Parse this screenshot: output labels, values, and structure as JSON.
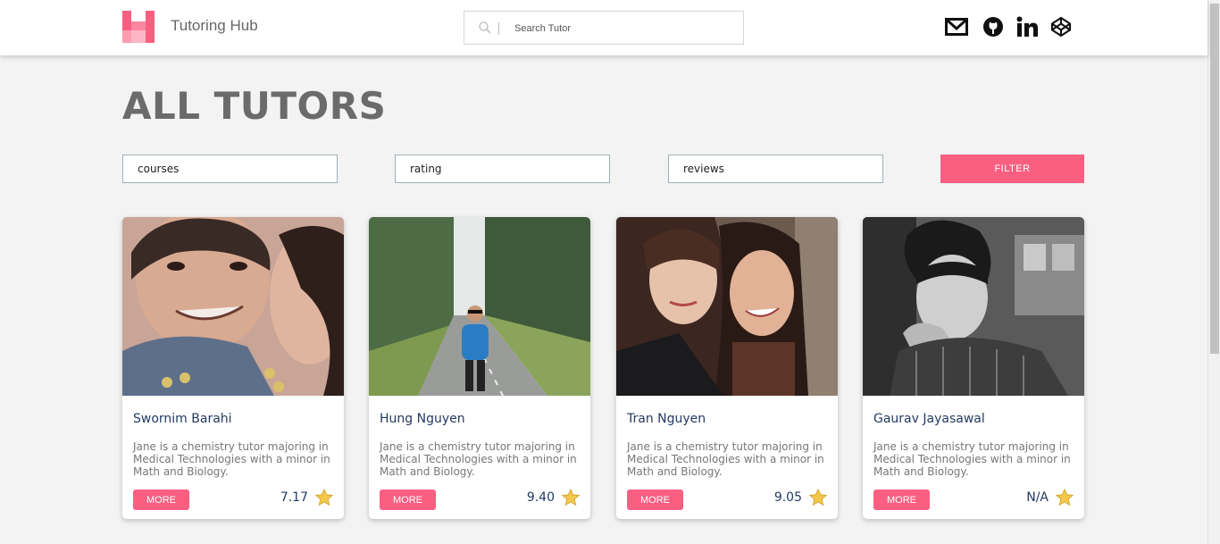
{
  "header": {
    "brand": "Tutoring Hub",
    "search_placeholder": "Search Tutor",
    "social": [
      "mail-icon",
      "github-icon",
      "linkedin-icon",
      "codepen-icon"
    ]
  },
  "page": {
    "title": "ALL TUTORS"
  },
  "filters": {
    "courses": "courses",
    "rating": "rating",
    "reviews": "reviews",
    "button": "FILTER"
  },
  "colors": {
    "accent": "#fa5f82",
    "name": "#233a63",
    "title": "#6b6b6b",
    "star": "#f5c84a"
  },
  "tutors": [
    {
      "name": "Swornim Barahi",
      "description": "Jane is a chemistry tutor majoring in Medical Technologies with a minor in Math and Biology.",
      "button": "MORE",
      "rating": "7.17"
    },
    {
      "name": "Hung Nguyen",
      "description": "Jane is a chemistry tutor majoring in Medical Technologies with a minor in Math and Biology.",
      "button": "MORE",
      "rating": "9.40"
    },
    {
      "name": "Tran Nguyen",
      "description": "Jane is a chemistry tutor majoring in Medical Technologies with a minor in Math and Biology.",
      "button": "MORE",
      "rating": "9.05"
    },
    {
      "name": "Gaurav Jayasawal",
      "description": "Jane is a chemistry tutor majoring in Medical Technologies with a minor in Math and Biology.",
      "button": "MORE",
      "rating": "N/A"
    }
  ]
}
